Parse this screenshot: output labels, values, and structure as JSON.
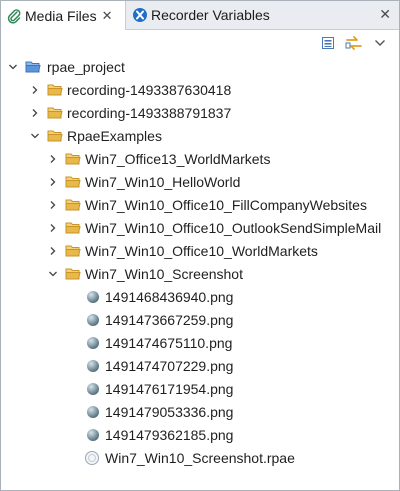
{
  "tabs": {
    "active_label": "Media Files",
    "inactive_label": "Recorder Variables",
    "close_glyph": "✕"
  },
  "toolbar": {
    "collapse_all_icon": "collapse-all-icon",
    "link_editor_icon": "link-with-editor-icon",
    "view_menu_icon": "view-menu-icon"
  },
  "tree": {
    "root": "rpae_project",
    "recording1": "recording-1493387630418",
    "recording2": "recording-1493388791837",
    "examples": "RpaeExamples",
    "ex1": "Win7_Office13_WorldMarkets",
    "ex2": "Win7_Win10_HelloWorld",
    "ex3": "Win7_Win10_Office10_FillCompanyWebsites",
    "ex4": "Win7_Win10_Office10_OutlookSendSimpleMail",
    "ex5": "Win7_Win10_Office10_WorldMarkets",
    "ex6": "Win7_Win10_Screenshot",
    "files": [
      "1491468436940.png",
      "1491473667259.png",
      "1491474675110.png",
      "1491474707229.png",
      "1491476171954.png",
      "1491479053336.png",
      "1491479362185.png"
    ],
    "rpae_file": "Win7_Win10_Screenshot.rpae"
  },
  "colors": {
    "folder": "#e8b84a",
    "folder_dark": "#c99526",
    "project_folder": "#4d8fd6",
    "png_ball": "#5f7a8a",
    "accent_blue": "#2463c0"
  }
}
